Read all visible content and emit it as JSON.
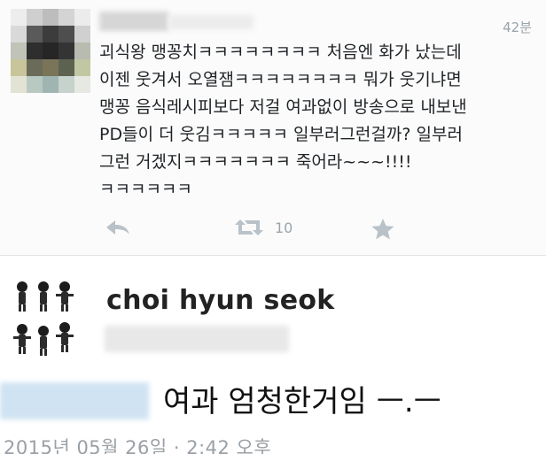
{
  "tweet1": {
    "timestamp": "42분",
    "text": "괴식왕 맹꽁치ㅋㅋㅋㅋㅋㅋㅋㅋ 처음엔 화가 났는데\n이젠 웃겨서 오열잼ㅋㅋㅋㅋㅋㅋㅋㅋ 뭐가 웃기냐면\n맹꽁 음식레시피보다 저걸 여과없이 방송으로 내보낸\nPD들이 더 웃김ㅋㅋㅋㅋㅋ 일부러그런걸까? 일부러\n그런 거겠지ㅋㅋㅋㅋㅋㅋㅋ 죽어라~~~!!!!\nㅋㅋㅋㅋㅋㅋ",
    "actions": {
      "reply_icon": "reply-icon",
      "retweet_icon": "retweet-icon",
      "retweet_count": "10",
      "favorite_icon": "star-icon"
    }
  },
  "tweet2": {
    "username": "choi hyun seok",
    "text": "여과 엄청한거임 ㅡ.ㅡ",
    "date": "2015년 05월 26일 · 2:42 오후"
  }
}
